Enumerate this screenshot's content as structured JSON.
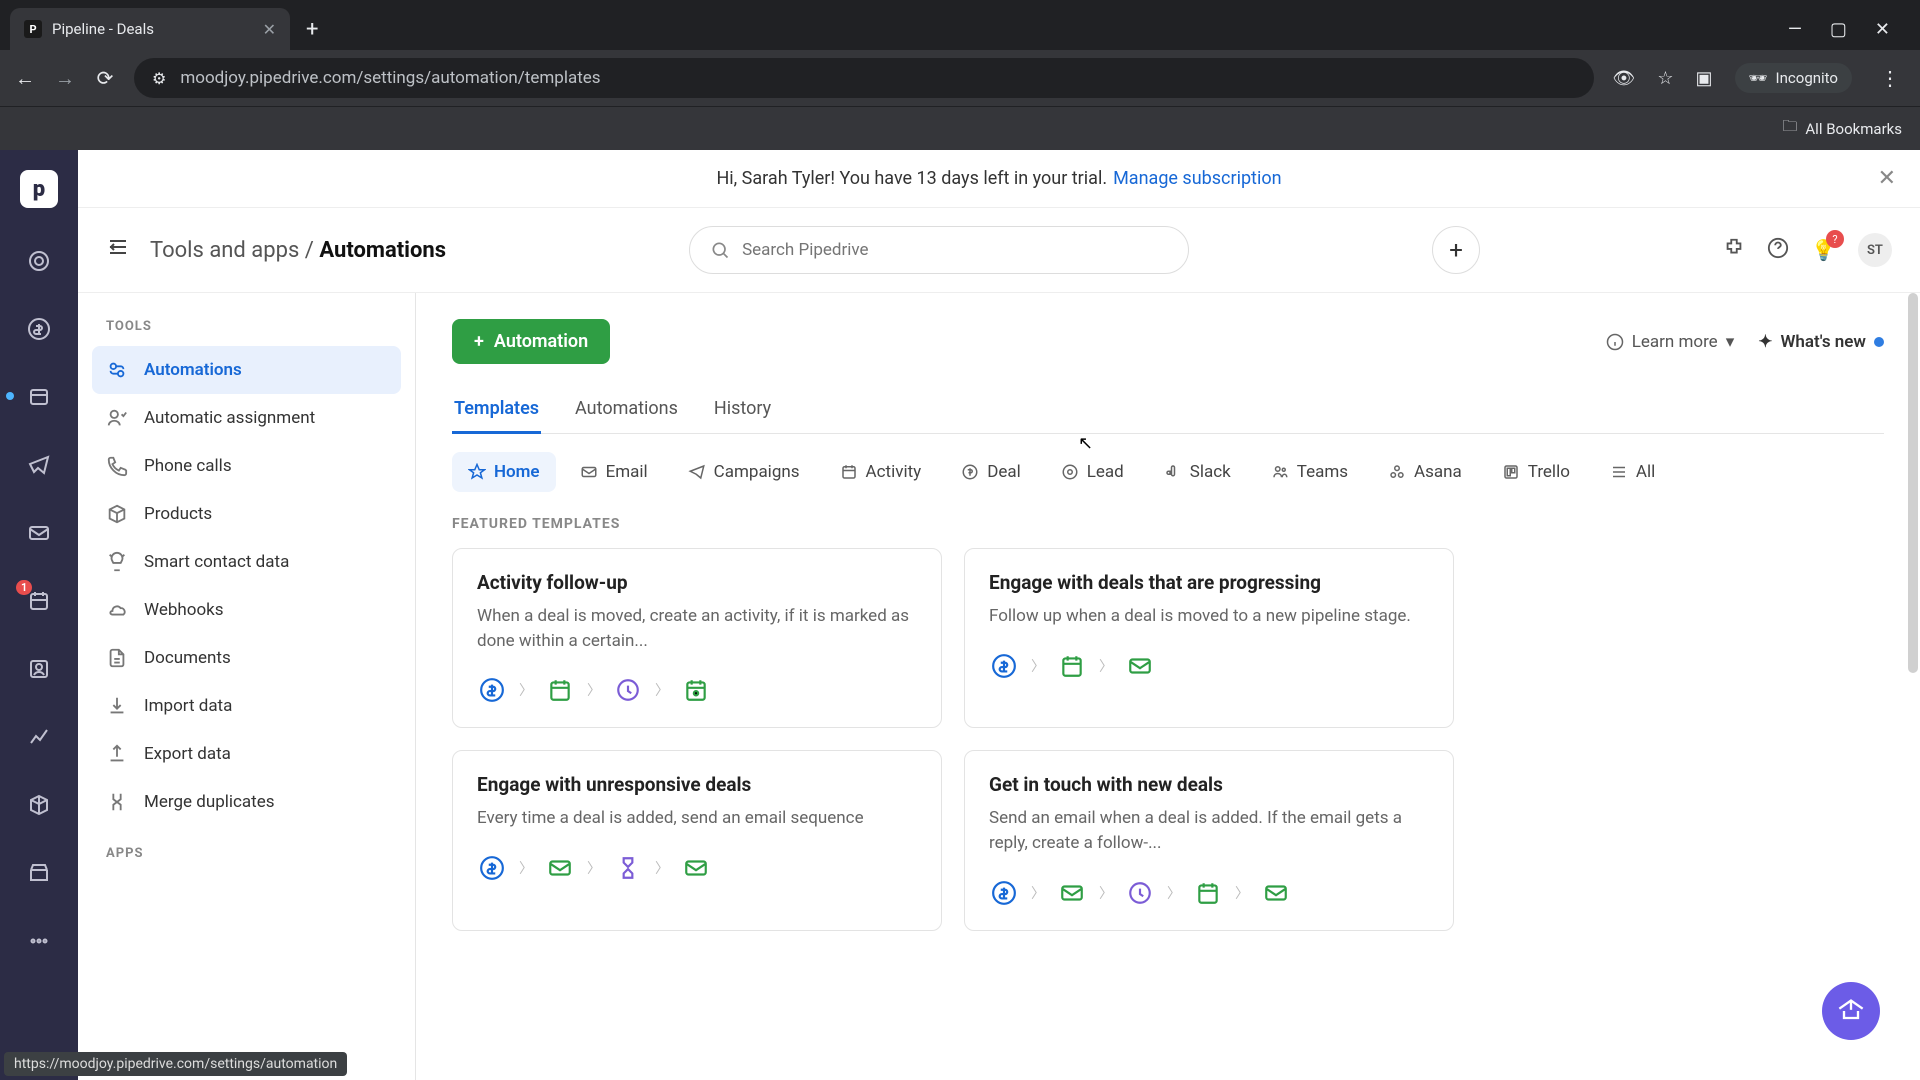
{
  "browser": {
    "tab_title": "Pipeline - Deals",
    "url": "moodjoy.pipedrive.com/settings/automation/templates",
    "incognito_label": "Incognito",
    "all_bookmarks": "All Bookmarks"
  },
  "banner": {
    "greeting": "Hi, Sarah Tyler! You have 13 days left in your trial.",
    "cta": "Manage subscription"
  },
  "breadcrumb": {
    "root": "Tools and apps",
    "current": "Automations"
  },
  "search": {
    "placeholder": "Search Pipedrive"
  },
  "header": {
    "learn_more": "Learn more",
    "whats_new": "What's new",
    "avatar": "ST",
    "bulb_badge": "?"
  },
  "sidebar": {
    "heading": "TOOLS",
    "apps_heading": "APPS",
    "items": [
      {
        "label": "Automations",
        "active": true
      },
      {
        "label": "Automatic assignment"
      },
      {
        "label": "Phone calls"
      },
      {
        "label": "Products"
      },
      {
        "label": "Smart contact data"
      },
      {
        "label": "Webhooks"
      },
      {
        "label": "Documents"
      },
      {
        "label": "Import data"
      },
      {
        "label": "Export data"
      },
      {
        "label": "Merge duplicates"
      }
    ]
  },
  "main": {
    "button": "Automation",
    "tabs": [
      {
        "label": "Templates",
        "active": true
      },
      {
        "label": "Automations"
      },
      {
        "label": "History"
      }
    ],
    "filters": [
      {
        "label": "Home",
        "active": true
      },
      {
        "label": "Email"
      },
      {
        "label": "Campaigns"
      },
      {
        "label": "Activity"
      },
      {
        "label": "Deal"
      },
      {
        "label": "Lead"
      },
      {
        "label": "Slack"
      },
      {
        "label": "Teams"
      },
      {
        "label": "Asana"
      },
      {
        "label": "Trello"
      },
      {
        "label": "All"
      }
    ],
    "section_label": "FEATURED TEMPLATES",
    "cards": [
      {
        "title": "Activity follow-up",
        "desc": "When a deal is moved, create an activity, if it is marked as done within a certain...",
        "flow": [
          "deal",
          "cal",
          "clock",
          "cal2"
        ]
      },
      {
        "title": "Engage with deals that are progressing",
        "desc": "Follow up when a deal is moved to a new pipeline stage.",
        "flow": [
          "deal",
          "cal",
          "mail"
        ]
      },
      {
        "title": "Engage with unresponsive deals",
        "desc": "Every time a deal is added, send an email sequence",
        "flow": [
          "deal",
          "mail",
          "hour",
          "mail"
        ]
      },
      {
        "title": "Get in touch with new deals",
        "desc": "Send an email when a deal is added. If the email gets a reply, create a follow-...",
        "flow": [
          "deal",
          "mail",
          "clock",
          "cal",
          "mail"
        ]
      }
    ]
  },
  "rail_badge": "1",
  "status_url": "https://moodjoy.pipedrive.com/settings/automation"
}
